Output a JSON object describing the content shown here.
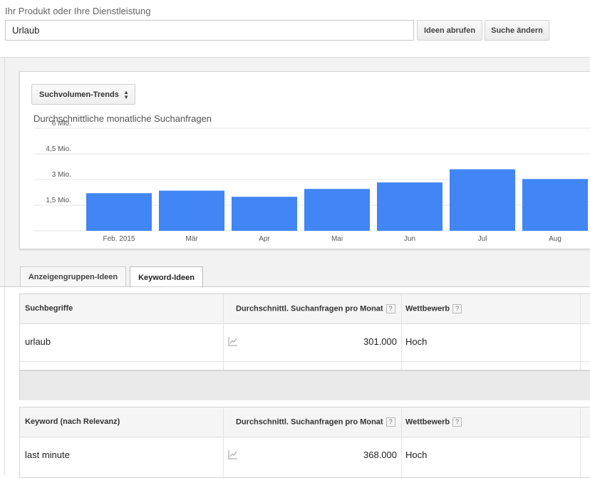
{
  "search": {
    "label": "Ihr Produkt oder Ihre Dienstleistung",
    "value": "Urlaub",
    "ideas_button": "Ideen abrufen",
    "change_button": "Suche ändern"
  },
  "chart_panel": {
    "selector_label": "Suchvolumen-Trends",
    "title": "Durchschnittliche monatliche Suchanfragen"
  },
  "chart_data": {
    "type": "bar",
    "title": "Durchschnittliche monatliche Suchanfragen",
    "categories": [
      "Feb. 2015",
      "Mär",
      "Apr",
      "Mai",
      "Jun",
      "Jul",
      "Aug"
    ],
    "values": [
      2.2,
      2.35,
      1.99,
      2.45,
      2.83,
      3.6,
      3.03
    ],
    "unit": "Mio.",
    "ytick_labels": [
      "1,5 Mio.",
      "3 Mio.",
      "4,5 Mio.",
      "6 Mio."
    ],
    "yticks": [
      1.5,
      3,
      4.5,
      6
    ],
    "ylim": [
      0,
      6
    ],
    "grid": true,
    "color": "#4285f4"
  },
  "tabs": [
    {
      "label": "Anzeigengruppen-Ideen",
      "active": false
    },
    {
      "label": "Keyword-Ideen",
      "active": true
    }
  ],
  "search_terms_table": {
    "headers": {
      "term": "Suchbegriffe",
      "volume": "Durchschnittl. Suchanfragen pro Monat",
      "competition": "Wettbewerb"
    },
    "rows": [
      {
        "term": "urlaub",
        "volume": "301.000",
        "competition": "Hoch"
      }
    ]
  },
  "keyword_table": {
    "headers": {
      "term": "Keyword (nach Relevanz)",
      "volume": "Durchschnittl. Suchanfragen pro Monat",
      "competition": "Wettbewerb"
    },
    "rows": [
      {
        "term": "last minute",
        "volume": "368.000",
        "competition": "Hoch"
      }
    ]
  },
  "help_glyph": "?"
}
